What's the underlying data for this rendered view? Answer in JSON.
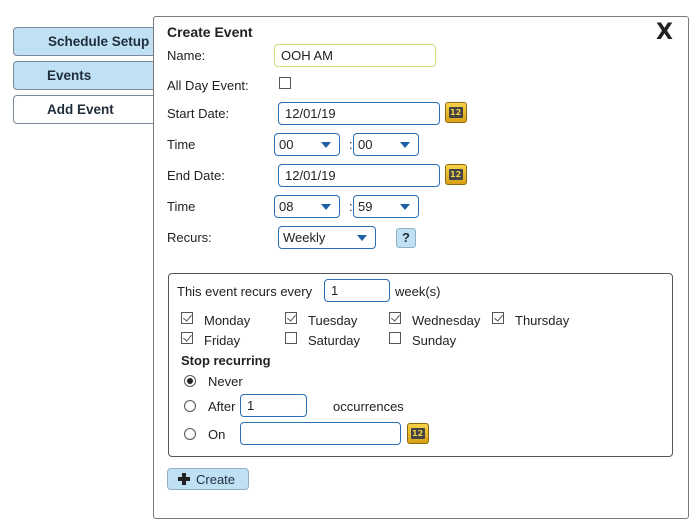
{
  "tabs": [
    {
      "label": "Schedule Setup"
    },
    {
      "label": "Events"
    },
    {
      "label": "Add Event"
    }
  ],
  "dialog": {
    "title": "Create Event",
    "close_label": "X",
    "name_label": "Name:",
    "name_value": "OOH AM",
    "all_day_label": "All Day Event:",
    "all_day_checked": false,
    "start_date_label": "Start Date:",
    "start_date_value": "12/01/19",
    "time_label": "Time",
    "start_hour": "00",
    "start_minute": "00",
    "time_separator": ":",
    "end_date_label": "End Date:",
    "end_date_value": "12/01/19",
    "end_hour": "08",
    "end_minute": "59",
    "recurs_label": "Recurs:",
    "recurs_value": "Weekly",
    "help_label": "?",
    "calendar_icon_text": "12",
    "create_label": "Create"
  },
  "recurrence": {
    "every_prefix": "This event recurs every",
    "every_value": "1",
    "every_suffix": "week(s)",
    "days": [
      {
        "label": "Monday",
        "checked": true
      },
      {
        "label": "Tuesday",
        "checked": true
      },
      {
        "label": "Wednesday",
        "checked": true
      },
      {
        "label": "Thursday",
        "checked": true
      },
      {
        "label": "Friday",
        "checked": true
      },
      {
        "label": "Saturday",
        "checked": false
      },
      {
        "label": "Sunday",
        "checked": false
      }
    ],
    "stop_heading": "Stop recurring",
    "never_label": "Never",
    "after_label": "After",
    "after_value": "1",
    "occurrences_label": "occurrences",
    "on_label": "On",
    "on_value": "",
    "selected_stop": "never"
  },
  "icons": {
    "calendar": "calendar-icon",
    "close": "close-icon",
    "plus": "plus-icon",
    "dropdown": "chevron-down-icon"
  },
  "colors": {
    "tab_active_bg": "#bfe1f3",
    "input_border": "#2b6fb5",
    "calendar_gold": "#f7d34a"
  }
}
